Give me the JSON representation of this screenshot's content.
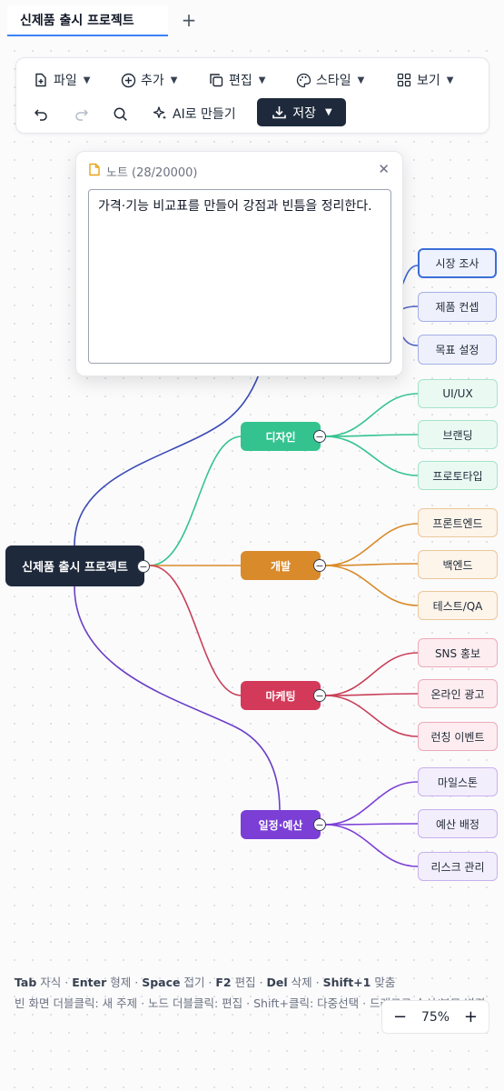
{
  "tabs": [
    {
      "label": "신제품 출시 프로젝트"
    }
  ],
  "toolbar": {
    "file": "파일",
    "add": "추가",
    "edit": "편집",
    "style": "스타일",
    "view": "보기",
    "ai": "AI로 만들기",
    "save": "저장"
  },
  "note": {
    "title": "노트 (28/20000)",
    "text": "가격·기능 비교표를 만들어 강점과 빈틈을 정리한다."
  },
  "mindmap": {
    "root": "신제품 출시 프로젝트",
    "planning_children": [
      "시장 조사",
      "제품 컨셉",
      "목표 설정"
    ],
    "categories": [
      {
        "label": "디자인",
        "color": "#34c38f",
        "children": [
          "UI/UX",
          "브랜딩",
          "프로토타입"
        ]
      },
      {
        "label": "개발",
        "color": "#d98a2b",
        "children": [
          "프론트엔드",
          "백엔드",
          "테스트/QA"
        ]
      },
      {
        "label": "마케팅",
        "color": "#d33a5a",
        "children": [
          "SNS 홍보",
          "온라인 광고",
          "런칭 이벤트"
        ]
      },
      {
        "label": "일정·예산",
        "color": "#7b3fd6",
        "children": [
          "마일스톤",
          "예산 배정",
          "리스크 관리"
        ]
      }
    ]
  },
  "help": {
    "k1": "Tab",
    "t1": " 자식 · ",
    "k2": "Enter",
    "t2": " 형제 · ",
    "k3": "Space",
    "t3": " 접기 · ",
    "k4": "F2",
    "t4": " 편집 · ",
    "k5": "Del",
    "t5": " 삭제 · ",
    "k6": "Shift+1",
    "t6": " 맞춤",
    "line2": "빈 화면 더블클릭: 새 주제 · 노드 더블클릭: 편집 · Shift+클릭: 다중선택 · 드래그로 순서/부모 변경"
  },
  "zoom": {
    "minus": "−",
    "value": "75%",
    "plus": "+"
  }
}
